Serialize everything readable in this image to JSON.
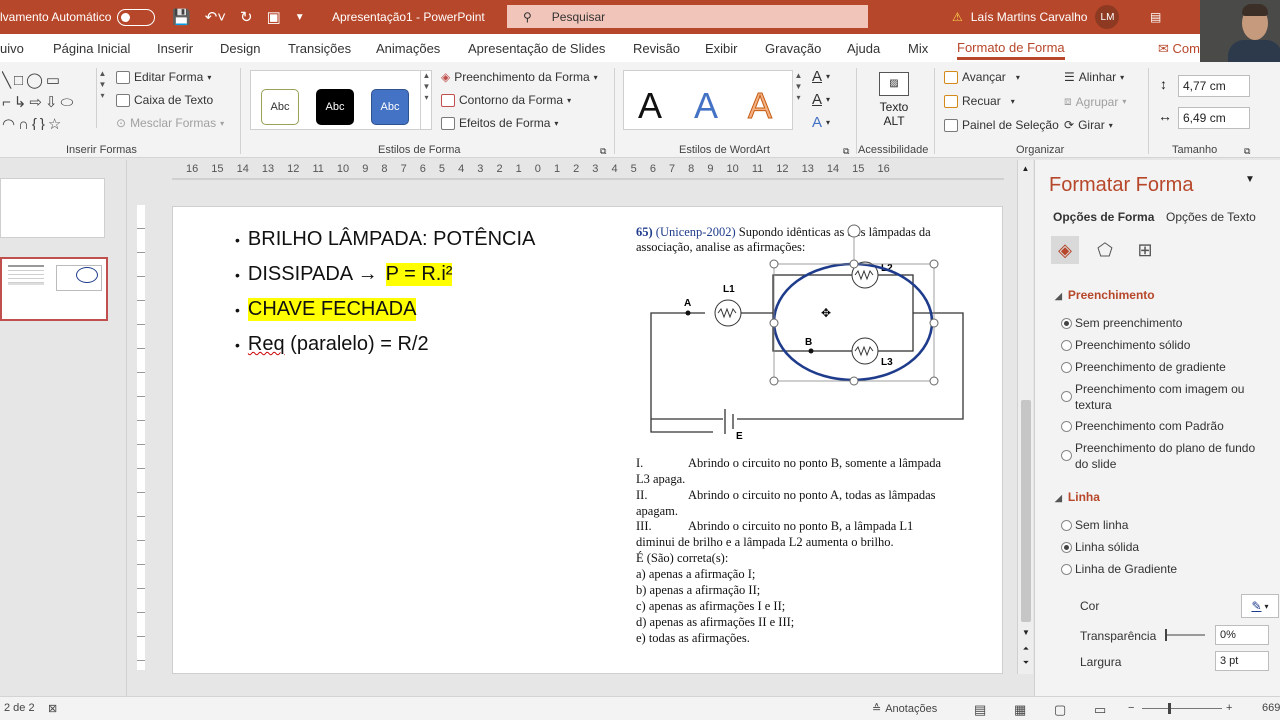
{
  "titlebar": {
    "autosave_label": "lvamento Automático",
    "doc_title": "Apresentação1 - PowerPoint",
    "search_placeholder": "Pesquisar",
    "user_name": "Laís Martins Carvalho",
    "user_initials": "LM",
    "warning_icon": "warning-icon"
  },
  "tabs": [
    "uivo",
    "Página Inicial",
    "Inserir",
    "Design",
    "Transições",
    "Animações",
    "Apresentação de Slides",
    "Revisão",
    "Exibir",
    "Gravação",
    "Ajuda",
    "Mix",
    "Formato de Forma",
    "Com"
  ],
  "active_tab": "Formato de Forma",
  "ribbon": {
    "insert_shapes": {
      "label": "Inserir Formas",
      "edit_shape": "Editar Forma",
      "text_box": "Caixa de Texto",
      "merge_shapes": "Mesclar Formas"
    },
    "shape_styles": {
      "label": "Estilos de Forma",
      "sample": "Abc",
      "fill": "Preenchimento da Forma",
      "outline": "Contorno da Forma",
      "effects": "Efeitos de Forma"
    },
    "wordart": {
      "label": "Estilos de WordArt",
      "letter": "A"
    },
    "accessibility": {
      "label": "Acessibilidade",
      "alt_text_line1": "Texto",
      "alt_text_line2": "ALT"
    },
    "arrange": {
      "label": "Organizar",
      "bring_forward": "Avançar",
      "send_backward": "Recuar",
      "selection_pane": "Painel de Seleção",
      "align": "Alinhar",
      "group": "Agrupar",
      "rotate": "Girar"
    },
    "size": {
      "label": "Tamanho",
      "height": "4,77 cm",
      "width": "6,49 cm"
    }
  },
  "ruler": "16 15 14 13 12 11 10 9 8 7 6 5 4 3 2 1 0 1 2 3 4 5 6 7 8 9 10 11 12 13 14 15 16",
  "slide": {
    "bullets": [
      {
        "text": "BRILHO LÂMPADA: POTÊNCIA"
      },
      {
        "text": "DISSIPADA ",
        "arrow": "→",
        "highlight": "P = R.i²"
      },
      {
        "text": "",
        "highlight": "CHAVE FECHADA"
      },
      {
        "squiggle": "Req",
        "text": " (paralelo) = R/2"
      }
    ],
    "question": {
      "number": "65)",
      "source": "(Unicenp-2002)",
      "line1": "Supondo idênticas as três lâmpadas da",
      "line2": "associação, analise as afirmações:",
      "circuit_labels": {
        "A": "A",
        "B": "B",
        "E": "E",
        "L1": "L1",
        "L2": "L2",
        "L3": "L3"
      },
      "statements": [
        {
          "roman": "I.",
          "text": "Abrindo o circuito no ponto B, somente a lâmpada",
          "cont": "L3 apaga."
        },
        {
          "roman": "II.",
          "text": "Abrindo o circuito no ponto A, todas as lâmpadas",
          "cont": "apagam."
        },
        {
          "roman": "III.",
          "text": "Abrindo o circuito no ponto B, a lâmpada L1",
          "cont": "diminui de brilho e a lâmpada L2 aumenta o brilho."
        }
      ],
      "prompt": "É (São) correta(s):",
      "options": [
        "a) apenas a afirmação I;",
        "b) apenas a afirmação II;",
        "c) apenas as afirmações I e II;",
        "d) apenas as afirmações II e III;",
        "e) todas as afirmações."
      ]
    }
  },
  "format_pane": {
    "title": "Formatar Forma",
    "tab_shape": "Opções de Forma",
    "tab_text": "Opções de Texto",
    "fill_section": "Preenchimento",
    "fill_options": [
      "Sem preenchimento",
      "Preenchimento sólido",
      "Preenchimento de gradiente",
      "Preenchimento com imagem ou",
      "textura",
      "Preenchimento com Padrão",
      "Preenchimento do plano de fundo",
      "do slide"
    ],
    "fill_selected": "Sem preenchimento",
    "line_section": "Linha",
    "line_options": [
      "Sem linha",
      "Linha sólida",
      "Linha de Gradiente"
    ],
    "line_selected": "Linha sólida",
    "color_label": "Cor",
    "transparency_label": "Transparência",
    "transparency_value": "0%",
    "width_label": "Largura",
    "width_value": "3 pt"
  },
  "statusbar": {
    "slide_info": "2 de 2",
    "notes": "Anotações",
    "zoom": "669"
  },
  "colors": {
    "accent": "#b7472a",
    "highlight": "#ffff00",
    "ellipse": "#1f3c8c"
  }
}
